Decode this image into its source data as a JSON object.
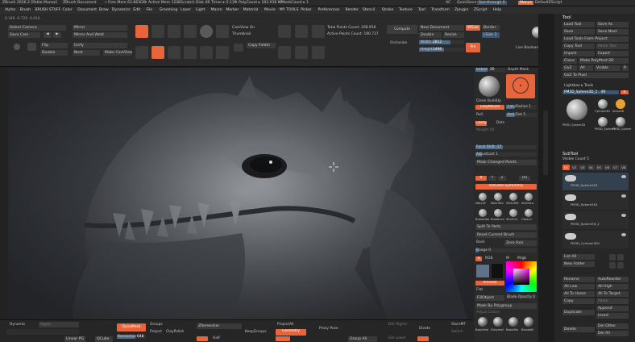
{
  "title_bar": {
    "app": "ZBrush 2026.2 [Pablo Munoz]",
    "doc": "ZBrush Document",
    "free_mem": "• Free Mem 63.863GB",
    "active_mem": "• Active Mem 1222",
    "scratch": "• Scratch Disk 45",
    "timer": "• Timer ▸ 0.139",
    "polycount": "• PolyCount ▸ 193.936 KP",
    "meshcount": "• MeshCount ▸ 1",
    "ac": "AC",
    "quicksave": "QuickSave",
    "see_through": "See-through",
    "see_through_val": "0",
    "menus": "Menus",
    "default_script": "DefaultZScript"
  },
  "menu_bar": [
    "Alpha",
    "Brush",
    "BRUSH STUFF",
    "Color",
    "Document",
    "Draw",
    "Dynamics",
    "Edit",
    "File",
    "Grooming",
    "Layer",
    "Light",
    "Macro",
    "Marker",
    "Material",
    "Movie",
    "MY TOOLS",
    "Picker",
    "Preferences",
    "Render",
    "Stencil",
    "Stroke",
    "Texture",
    "Tool",
    "Transform",
    "Zplugin",
    "ZScript",
    "Help"
  ],
  "shelf": {
    "coords": "0.346 -0.726 -0.016",
    "select_camera": "Select Camera",
    "save_cam": "Save Cam",
    "flip": "Flip",
    "double": "Double",
    "mirror": "Mirror",
    "mirror_weld": "Mirror And Weld",
    "unify": "Unify",
    "next": "Next",
    "make_camview": "Make CamView",
    "icons": [
      "Draw",
      "Move",
      "Scale",
      "Rotate"
    ],
    "camview": "CamView On",
    "thumbnail": "Thumbnail",
    "copy_folder": "Copy Folder",
    "total_points": "Total Points Count: 268.958",
    "active_points": "Active Points Count: 190.737",
    "compute": "Compute",
    "occlusion": "Occlusion",
    "new_document": "New Document",
    "double2": "Double",
    "resize": "Resize",
    "wsize": "WSize",
    "border": "Border",
    "lsize": "LSize 3",
    "width_label": "Width",
    "width_val": "2812",
    "height_label": "Height",
    "height_val": "1496",
    "pro": "Pro",
    "live_boolean": "Live Boolean"
  },
  "mid_panel": {
    "imbed": "Imbed",
    "imbed_val": "20",
    "depth_mask": "Depth Mask",
    "clean_buildup": "Clean BuildUp",
    "lazy_mouse": "LazyMouse",
    "lazy_radius": "LazyRadius 1",
    "roll": "Roll",
    "roll_dist": "Roll Dist 5",
    "cavity": "Cavity",
    "dots": "Dots",
    "weight_str": "Weight Str",
    "focal_shift": "Focal Shift -17",
    "adjust_last": "AdjustLast 1",
    "mask_changed": "Mask Changed Points",
    "activate_symmetry": "Activate Symmetry",
    "split_to_parts": "Split To Parts",
    "reset_brush": "Reset Current Brush",
    "back": "Back",
    "zero_axis": "Zero Axis",
    "range": "Range 0",
    "rgb": "RGB",
    "m": "M",
    "mrgb": "Mrgb",
    "preview": "Preview",
    "flat": "Flat",
    "fill_object": "FillObject",
    "smooth_opacity": "Blade Opacity 0",
    "mask_polygroup": "Mask By Polygroup",
    "adjust_colors": "Adjust Colors",
    "brushes": [
      "MatchF",
      "MatchEd",
      "SelectRe",
      "SelectLa",
      "BrokenBo",
      "BrokenLa",
      "SliceCur",
      "ClipCur"
    ],
    "materials": [
      "BasicMat",
      "Dirtymat",
      "BasicMa",
      "BlondeB"
    ]
  },
  "right_panel": {
    "tool": "Tool",
    "load_tool": "Load Tool",
    "save_as": "Save As",
    "save": "Save",
    "save_next": "Save Next",
    "load_tools_project": "Load Tools From Project",
    "copy_tool": "Copy Tool",
    "paste_tool": "Paste Tool",
    "import": "Import",
    "export": "Export",
    "clone": "Clone",
    "make_polymesh": "Make PolyMesh3D",
    "goz": "GoZ",
    "all": "All",
    "visible": "Visible",
    "r": "R",
    "goz_photoshop": "GoZ To Pixol",
    "lightbox_tools": "Lightbox ▸ Tools",
    "pm3d_sphere": "PM3D_Sphere3D_1 . 49",
    "thumbs": [
      "PM3D_Sphere3D",
      "Cylinder3D",
      "SimpleB",
      "PM3D_Sphere3",
      "PM3D_Sphere"
    ],
    "subtool": "SubTool",
    "visible_count": "Visible Count 5",
    "v_tabs": [
      "V1",
      "V2",
      "V3",
      "V4",
      "V5",
      "V6",
      "V7",
      "V8"
    ],
    "subtools": [
      "PM3D_Sphere3D1",
      "PM3D_Sphere3D1",
      "PM3D_Sphere3D_2",
      "PM3D_Cylinder3D1"
    ],
    "list_all": "List All",
    "new_folder": "New Folder",
    "rename": "Rename",
    "auto_reorder": "AutoReorder",
    "all_low": "All Low",
    "all_high": "All High",
    "all_to_home": "All To Home",
    "all_to_target": "All To Target",
    "copy": "Copy",
    "paste": "Paste",
    "duplicate": "Duplicate",
    "append": "Append",
    "insert": "Insert",
    "delete": "Delete",
    "del_other": "Del Other",
    "del_all": "Del All"
  },
  "bottom": {
    "dynamic": "Dynamic",
    "apply": "Apply",
    "dynamesh": "DynaMesh",
    "groups": "Groups",
    "project": "Project",
    "polish": "ClayPolish",
    "zremesher": "ZRemesher",
    "keep_groups": "KeepGroups",
    "project_all": "ProjectAll",
    "geometry": "Geometry",
    "proxy_pose": "Proxy Pose",
    "del_higher": "Del Higher",
    "divide": "Divide",
    "store_mt": "StoreMT",
    "switch": "Switch",
    "resolution": "Resolution",
    "resolution_val": "648",
    "half": "Half",
    "group_all": "Group All",
    "del_lower": "Del Lower",
    "linear_pg": "Linear PG",
    "qcube": "QCube"
  }
}
